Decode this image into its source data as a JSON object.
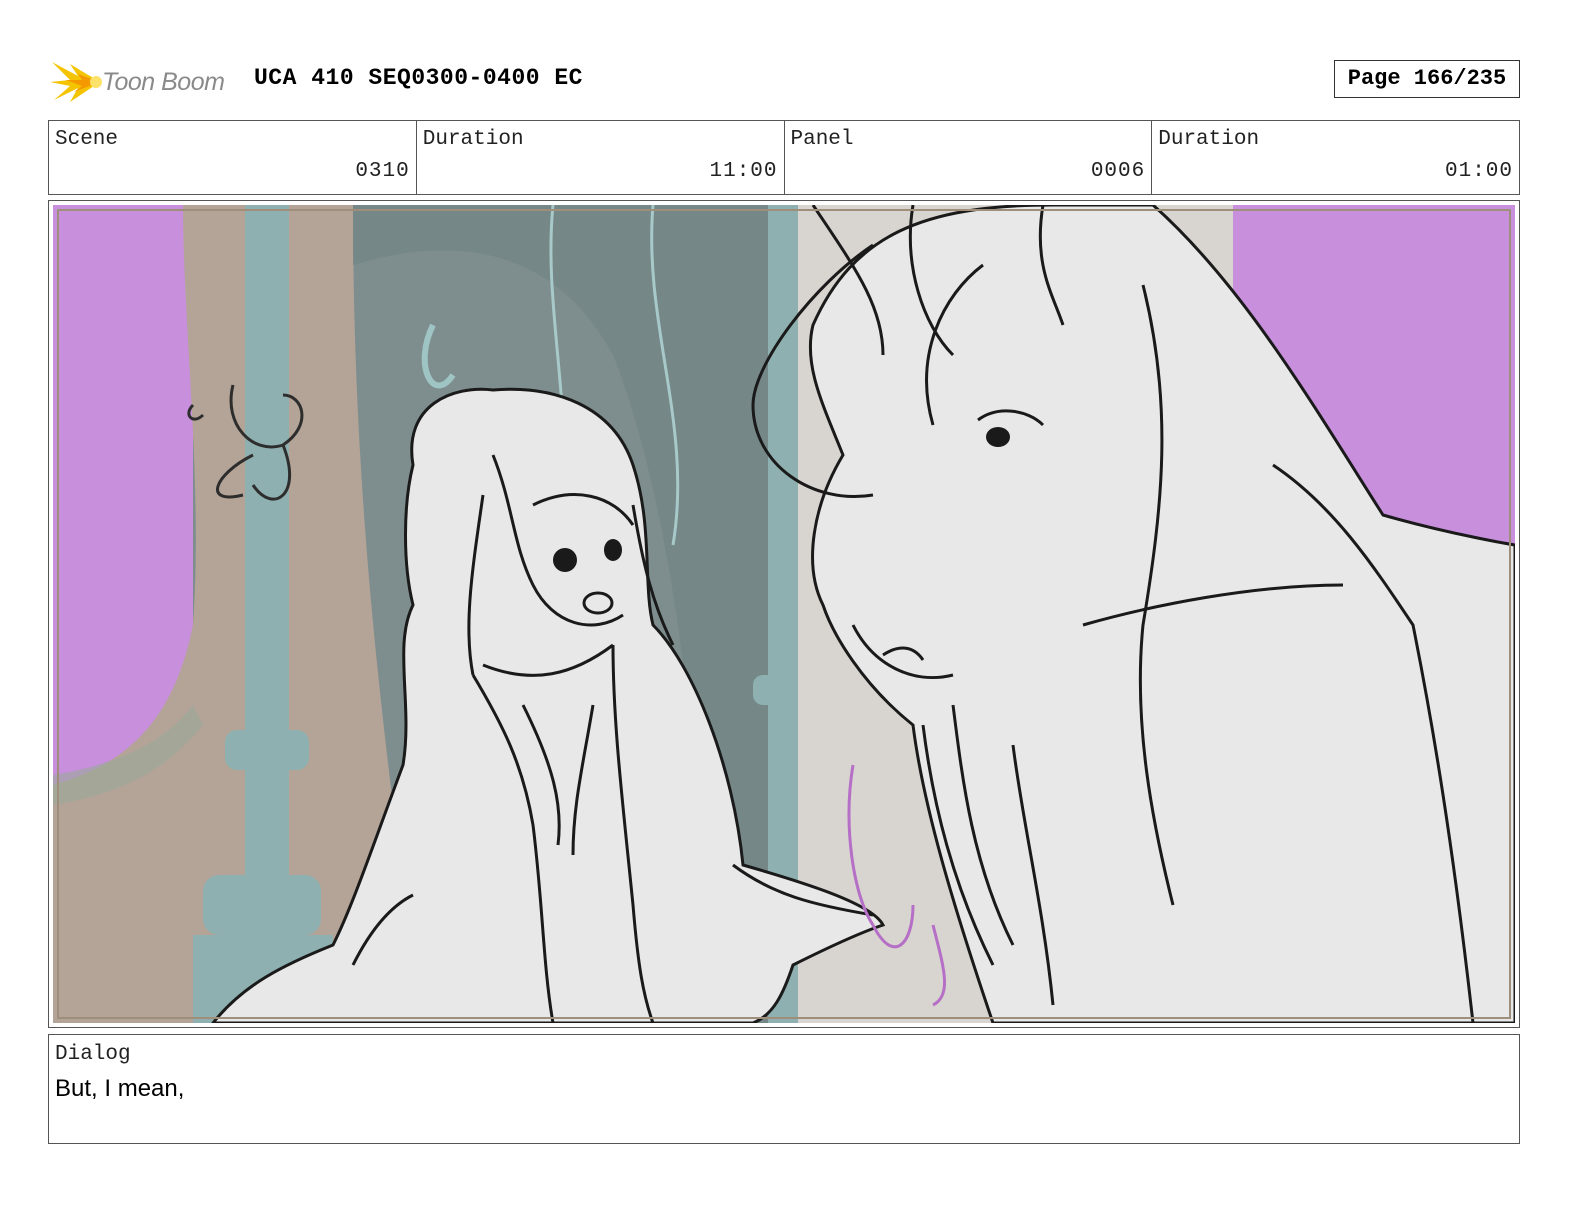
{
  "header": {
    "logo_text": "Toon Boom",
    "title": "UCA 410 SEQ0300-0400 EC",
    "page": "Page 166/235"
  },
  "info": {
    "scene_label": "Scene",
    "scene_value": "0310",
    "scene_duration_label": "Duration",
    "scene_duration_value": "11:00",
    "panel_label": "Panel",
    "panel_value": "0006",
    "panel_duration_label": "Duration",
    "panel_duration_value": "01:00"
  },
  "panel": {
    "colors": {
      "sky": "#c78fdc",
      "tree": "#b4a497",
      "interior": "#7e8e8e",
      "pillar": "#8fb0b0",
      "character_fill": "#e8e8e8",
      "ink": "#1a1a1a"
    }
  },
  "dialog": {
    "label": "Dialog",
    "text": "But, I mean,"
  }
}
